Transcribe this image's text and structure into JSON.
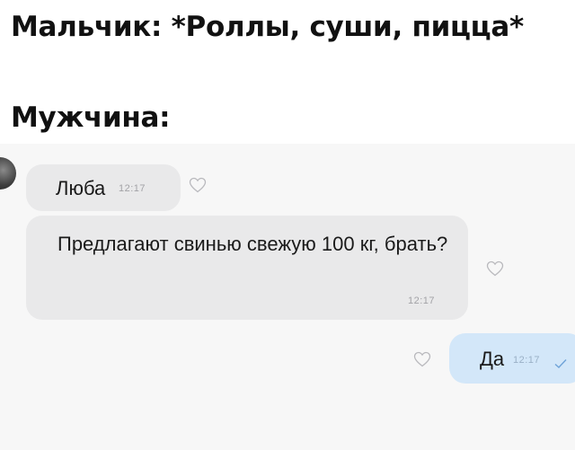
{
  "caption": {
    "line1": "Мальчик: *Роллы, суши, пицца*",
    "line2": "Мужчина:"
  },
  "messages": [
    {
      "text": "Люба",
      "time": "12:17",
      "direction": "incoming"
    },
    {
      "text": "Предлагают свинью свежую 100 кг, брать?",
      "time": "12:17",
      "direction": "incoming"
    },
    {
      "text": "Да",
      "time": "12:17",
      "direction": "outgoing",
      "status": "read"
    }
  ],
  "icons": {
    "reaction": "heart-outline-icon",
    "read_status": "check-icon"
  },
  "colors": {
    "chat_background": "#f7f7f7",
    "incoming_bubble": "#e9e9ea",
    "outgoing_bubble": "#d3e7f9",
    "timestamp": "#a2a2a6",
    "read_check": "#6fa3d8"
  }
}
